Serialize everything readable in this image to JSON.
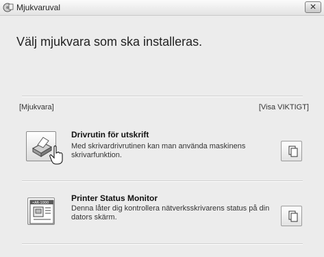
{
  "window": {
    "title": "Mjukvaruval",
    "close_label": "✕"
  },
  "heading": "Välj mjukvara som ska installeras.",
  "section": {
    "left_label": "[Mjukvara]",
    "right_link": "[Visa VIKTIGT]"
  },
  "items": [
    {
      "title": "Drivrutin för utskrift",
      "description": "Med skrivardrivrutinen kan man använda maskinens skrivarfunktion.",
      "icon": "printer-icon",
      "doc_icon": "documents-icon"
    },
    {
      "title": "Printer Status Monitor",
      "description": "Denna låter dig kontrollera nätverksskrivarens status på din dators skärm.",
      "icon": "status-monitor-icon",
      "doc_icon": "documents-icon"
    }
  ]
}
